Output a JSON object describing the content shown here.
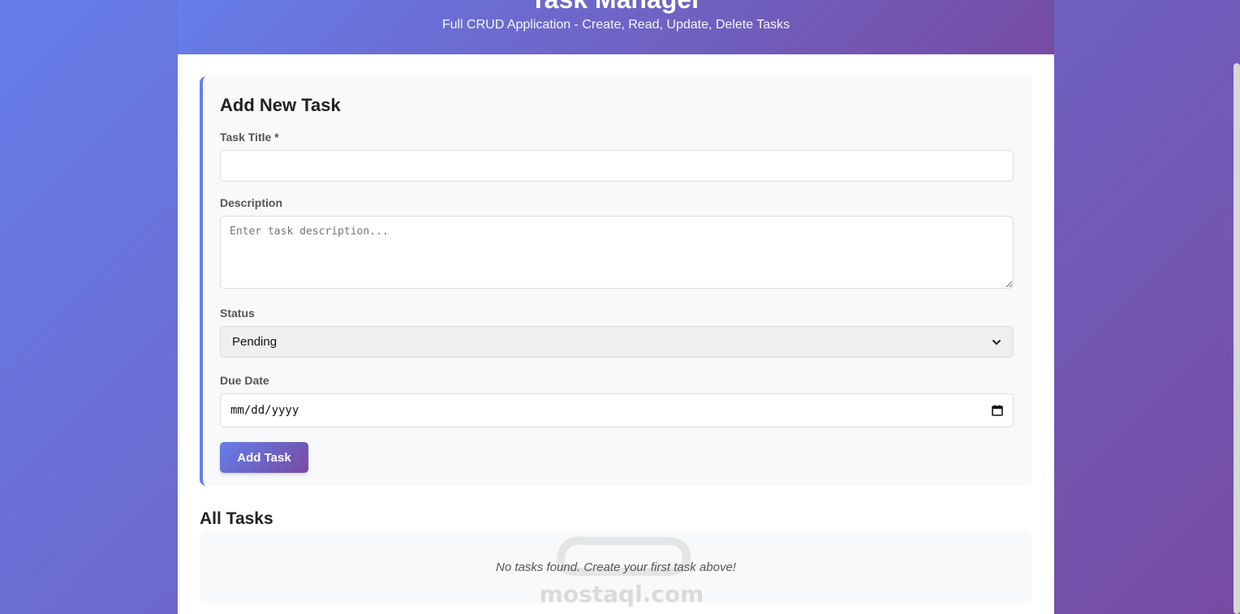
{
  "header": {
    "title": "Task Manager",
    "subtitle": "Full CRUD Application - Create, Read, Update, Delete Tasks"
  },
  "form": {
    "heading": "Add New Task",
    "title_label": "Task Title *",
    "title_value": "",
    "description_label": "Description",
    "description_placeholder": "Enter task description...",
    "status_label": "Status",
    "status_selected": "Pending",
    "due_label": "Due Date",
    "due_placeholder": "mm/dd/yyyy",
    "submit_label": "Add Task"
  },
  "tasks": {
    "heading": "All Tasks",
    "empty_message": "No tasks found. Create your first task above!"
  },
  "watermark": {
    "text": "mostaql.com"
  },
  "colors": {
    "gradient_start": "#667eea",
    "gradient_end": "#764ba2"
  }
}
